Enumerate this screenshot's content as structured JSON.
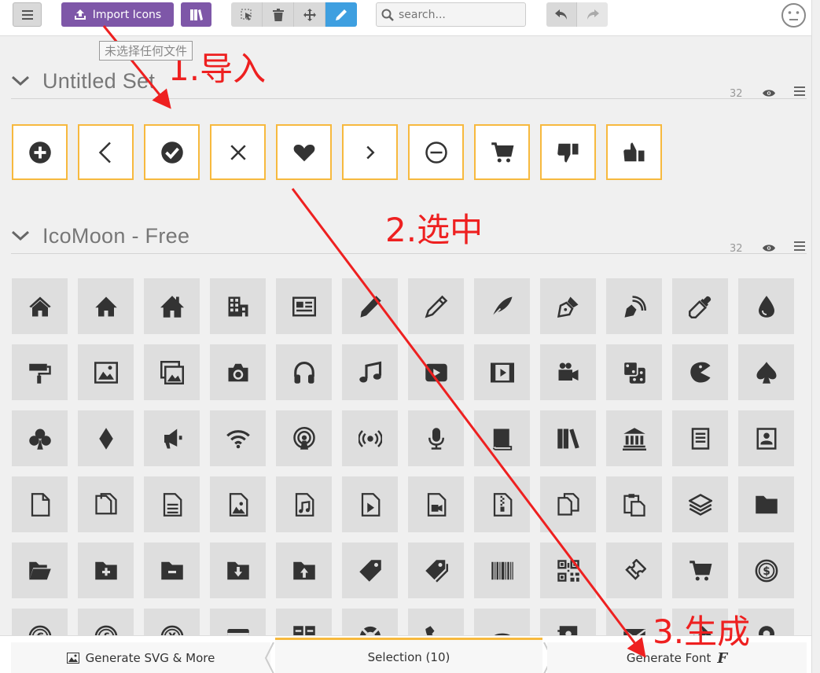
{
  "toolbar": {
    "import_label": "Import Icons",
    "search_placeholder": "search...",
    "accent_purple": "#7e57a8",
    "active_tool_color": "#3e9fe0"
  },
  "tooltip": "未选择任何文件",
  "sets": [
    {
      "title": "Untitled Set",
      "count": "32",
      "icons": [
        "plus-circle",
        "chevron-left",
        "check-circle",
        "close",
        "heart",
        "chevron-right",
        "minus-circle",
        "cart",
        "thumbs-down",
        "thumbs-up"
      ]
    },
    {
      "title": "IcoMoon - Free",
      "count": "32"
    }
  ],
  "free_icons": [
    [
      "home",
      "home2",
      "home3",
      "office",
      "newspaper",
      "pencil",
      "pencil2",
      "quill",
      "pen",
      "blog",
      "eyedropper",
      "droplet"
    ],
    [
      "paint-format",
      "image",
      "images",
      "camera",
      "headphones",
      "music",
      "play",
      "film",
      "video-camera",
      "dice",
      "pacman",
      "spades"
    ],
    [
      "clubs",
      "diamonds",
      "bullhorn",
      "connection",
      "podcast",
      "feed",
      "mic",
      "book",
      "books",
      "library",
      "file-text",
      "profile"
    ],
    [
      "file-empty",
      "files-empty",
      "file-text2",
      "file-picture",
      "file-music",
      "file-play",
      "file-video",
      "file-zip",
      "copy",
      "paste",
      "stack",
      "folder"
    ],
    [
      "folder-open",
      "folder-plus",
      "folder-minus",
      "folder-download",
      "folder-upload",
      "price-tag",
      "price-tags",
      "barcode",
      "qrcode",
      "ticket",
      "cart",
      "coin-dollar"
    ],
    [
      "coin-euro",
      "coin-pound",
      "coin-yen",
      "credit-card",
      "calculator",
      "lifebuoy",
      "phone",
      "phone-hang-up",
      "address-book",
      "envelop",
      "pushpin",
      "location"
    ]
  ],
  "bottombar": {
    "generate_svg_label": "Generate SVG & More",
    "selection_label": "Selection (10)",
    "generate_font_label": "Generate Font"
  },
  "annotations": {
    "step1": "1.导入",
    "step2": "2.选中",
    "step3": "3.生成",
    "color": "#ee2020"
  }
}
